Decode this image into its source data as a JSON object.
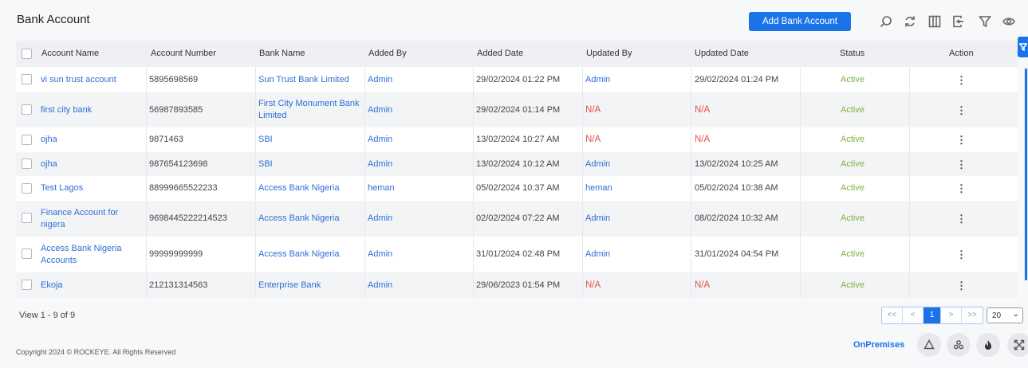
{
  "page": {
    "title": "Bank Account",
    "add_button": "Add Bank Account"
  },
  "toolbar": {
    "icons": [
      "search-icon",
      "refresh-icon",
      "columns-icon",
      "export-icon",
      "filter-icon",
      "eye-icon"
    ]
  },
  "table": {
    "columns": [
      "Account Name",
      "Account Number",
      "Bank Name",
      "Added By",
      "Added Date",
      "Updated By",
      "Updated Date",
      "Status",
      "Action"
    ],
    "rows": [
      {
        "account_name": "vi sun trust account",
        "account_number": "5895698569",
        "bank_name": "Sun Trust Bank Limited",
        "added_by": "Admin",
        "added_date": "29/02/2024 01:22 PM",
        "updated_by": "Admin",
        "updated_date": "29/02/2024 01:24 PM",
        "status": "Active"
      },
      {
        "account_name": "first city bank",
        "account_number": "56987893585",
        "bank_name": "First City Monument Bank Limited",
        "added_by": "Admin",
        "added_date": "29/02/2024 01:14 PM",
        "updated_by": "N/A",
        "updated_date": "N/A",
        "status": "Active"
      },
      {
        "account_name": "ojha",
        "account_number": "9871463",
        "bank_name": "SBI",
        "added_by": "Admin",
        "added_date": "13/02/2024 10:27 AM",
        "updated_by": "N/A",
        "updated_date": "N/A",
        "status": "Active"
      },
      {
        "account_name": "ojha",
        "account_number": "987654123698",
        "bank_name": "SBI",
        "added_by": "Admin",
        "added_date": "13/02/2024 10:12 AM",
        "updated_by": "Admin",
        "updated_date": "13/02/2024 10:25 AM",
        "status": "Active"
      },
      {
        "account_name": "Test Lagos",
        "account_number": "88999665522233",
        "bank_name": "Access Bank Nigeria",
        "added_by": "heman",
        "added_date": "05/02/2024 10:37 AM",
        "updated_by": "heman",
        "updated_date": "05/02/2024 10:38 AM",
        "status": "Active"
      },
      {
        "account_name": "Finance Account for nigera",
        "account_number": "9698445222214523",
        "bank_name": "Access Bank Nigeria",
        "added_by": "Admin",
        "added_date": "02/02/2024 07:22 AM",
        "updated_by": "Admin",
        "updated_date": "08/02/2024 10:32 AM",
        "status": "Active"
      },
      {
        "account_name": "Access Bank Nigeria Accounts",
        "account_number": "99999999999",
        "bank_name": "Access Bank Nigeria",
        "added_by": "Admin",
        "added_date": "31/01/2024 02:48 PM",
        "updated_by": "Admin",
        "updated_date": "31/01/2024 04:54 PM",
        "status": "Active"
      },
      {
        "account_name": "Ekoja",
        "account_number": "212131314563",
        "bank_name": "Enterprise Bank",
        "added_by": "Admin",
        "added_date": "29/06/2023 01:54 PM",
        "updated_by": "N/A",
        "updated_date": "N/A",
        "status": "Active"
      }
    ],
    "action_glyph": "⋮"
  },
  "pagination": {
    "view_info": "View 1 - 9 of 9",
    "first": "<<",
    "prev": "<",
    "current_page": "1",
    "next": ">",
    "last": ">>",
    "page_size": "20"
  },
  "footer": {
    "copyright": "Copyright 2024 © ROCKEYE. All Rights Reserved",
    "onpremises": "OnPremises"
  },
  "colors": {
    "accent": "#1a73e8",
    "link": "#2f6fd6",
    "na": "#e0524f",
    "active": "#7cb342"
  }
}
